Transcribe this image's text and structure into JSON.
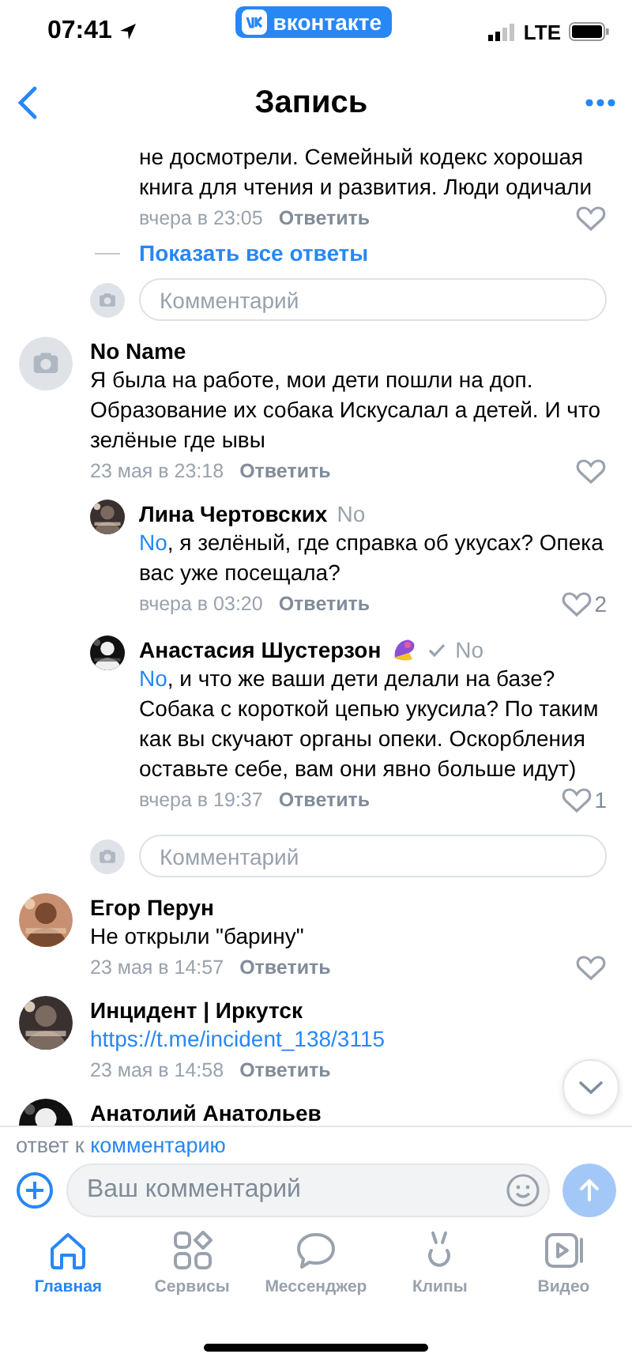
{
  "status_bar": {
    "time": "07:41",
    "app_badge": "вконтакте",
    "network": "LTE"
  },
  "header": {
    "title": "Запись"
  },
  "feed": [
    {
      "kind": "reply_tail",
      "text": "не досмотрели. Семейный кодекс хорошая книга для чтения и развития. Люди одичали",
      "time": "вчера в 23:05",
      "reply": "Ответить"
    },
    {
      "kind": "show_replies",
      "label": "Показать все ответы"
    },
    {
      "kind": "comment_field",
      "placeholder": "Комментарий"
    },
    {
      "kind": "comment",
      "avatar": {
        "kind": "placeholder"
      },
      "author": "No Name",
      "text": "Я была на работе, мои дети пошли на доп. Образование их собака Искусалал а детей. И что зелёные где ывы",
      "time": "23 мая в 23:18",
      "reply": "Ответить"
    },
    {
      "kind": "reply",
      "author": "Лина Чертовских",
      "sticker": false,
      "verified": false,
      "reply_to": "No",
      "mention": "No",
      "text": ", я зелёный, где справка об укусах? Опека вас уже посещала?",
      "time": "вчера в 03:20",
      "reply": "Ответить",
      "likes": "2"
    },
    {
      "kind": "reply",
      "author": "Анастасия Шустерзон",
      "sticker": true,
      "verified": true,
      "reply_to": "No",
      "mention": "No",
      "text": ", и что же ваши дети делали на базе? Собака с короткой цепью укусила? По таким как вы скучают органы опеки. Оскорбления оставьте себе, вам они явно больше идут)",
      "time": "вчера в 19:37",
      "reply": "Ответить",
      "likes": "1"
    },
    {
      "kind": "comment_field",
      "placeholder": "Комментарий"
    },
    {
      "kind": "comment",
      "author": "Егор Перун",
      "text": "Не открыли \"барину\"",
      "time": "23 мая в 14:57",
      "reply": "Ответить"
    },
    {
      "kind": "comment",
      "author": "Инцидент | Иркутск",
      "link": "https://t.me/incident_138/3115",
      "like_button": false,
      "time": "23 мая в 14:58",
      "reply": "Ответить"
    },
    {
      "kind": "comment",
      "author": "Анатолий Анатольев"
    }
  ],
  "composer": {
    "reply_prefix": "ответ к",
    "reply_link": "комментарию",
    "placeholder": "Ваш комментарий"
  },
  "tabs": [
    {
      "label": "Главная",
      "selected": true
    },
    {
      "label": "Сервисы",
      "selected": false
    },
    {
      "label": "Мессенджер",
      "selected": false
    },
    {
      "label": "Клипы",
      "selected": false
    },
    {
      "label": "Видео",
      "selected": false
    }
  ]
}
